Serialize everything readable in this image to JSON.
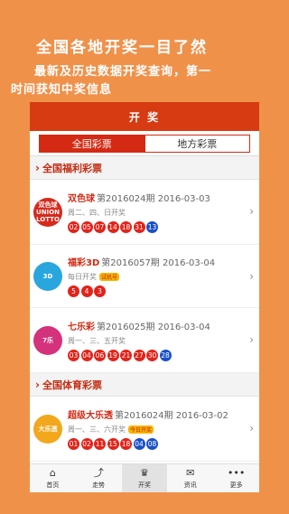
{
  "promo": {
    "line1": "全国各地开奖一目了然",
    "line2": "最新及历史数据开奖查询，第一",
    "line3": "时间获知中奖信息"
  },
  "app": {
    "title": "开 奖",
    "tabs": [
      "全国彩票",
      "地方彩票"
    ],
    "sections": [
      {
        "title": "全国福利彩票",
        "items": [
          {
            "name": "双色球",
            "issue": "第2016024期",
            "date": "2016-03-03",
            "schedule": "周二、四、日开奖",
            "tag": "",
            "logo_text": "双色球\nUNION LOTTO",
            "logo_color": "#d62a1c",
            "red": [
              "02",
              "05",
              "07",
              "14",
              "18",
              "31"
            ],
            "blue": [
              "13"
            ]
          },
          {
            "name": "福彩3D",
            "issue": "第2016057期",
            "date": "2016-03-04",
            "schedule": "每日开奖",
            "tag": "试机号",
            "logo_text": "3D",
            "logo_color": "#2aa6de",
            "red": [
              "5",
              "4",
              "3"
            ],
            "blue": []
          },
          {
            "name": "七乐彩",
            "issue": "第2016025期",
            "date": "2016-03-04",
            "schedule": "周一、三、五开奖",
            "tag": "",
            "logo_text": "7乐",
            "logo_color": "#d4327a",
            "red": [
              "03",
              "04",
              "06",
              "19",
              "21",
              "27",
              "30"
            ],
            "blue": [
              "28"
            ]
          }
        ]
      },
      {
        "title": "全国体育彩票",
        "items": [
          {
            "name": "超级大乐透",
            "issue": "第2016024期",
            "date": "2016-03-02",
            "schedule": "周一、三、六开奖",
            "tag": "今日开奖",
            "logo_text": "大乐透",
            "logo_color": "#f2a71c",
            "red": [
              "01",
              "02",
              "11",
              "15",
              "18"
            ],
            "blue": [
              "04",
              "08"
            ]
          }
        ]
      }
    ],
    "nav": [
      {
        "icon": "home-icon",
        "glyph": "⌂",
        "label": "首页"
      },
      {
        "icon": "trend-icon",
        "glyph": "⤴",
        "label": "走势"
      },
      {
        "icon": "trophy-icon",
        "glyph": "♛",
        "label": "开奖"
      },
      {
        "icon": "news-icon",
        "glyph": "✉",
        "label": "资讯"
      },
      {
        "icon": "more-icon",
        "glyph": "•••",
        "label": "更多"
      }
    ],
    "colors": {
      "accent": "#d42a14",
      "ball_red": "#e2231a",
      "ball_blue": "#1a4fc9",
      "background": "#f0914a"
    }
  }
}
